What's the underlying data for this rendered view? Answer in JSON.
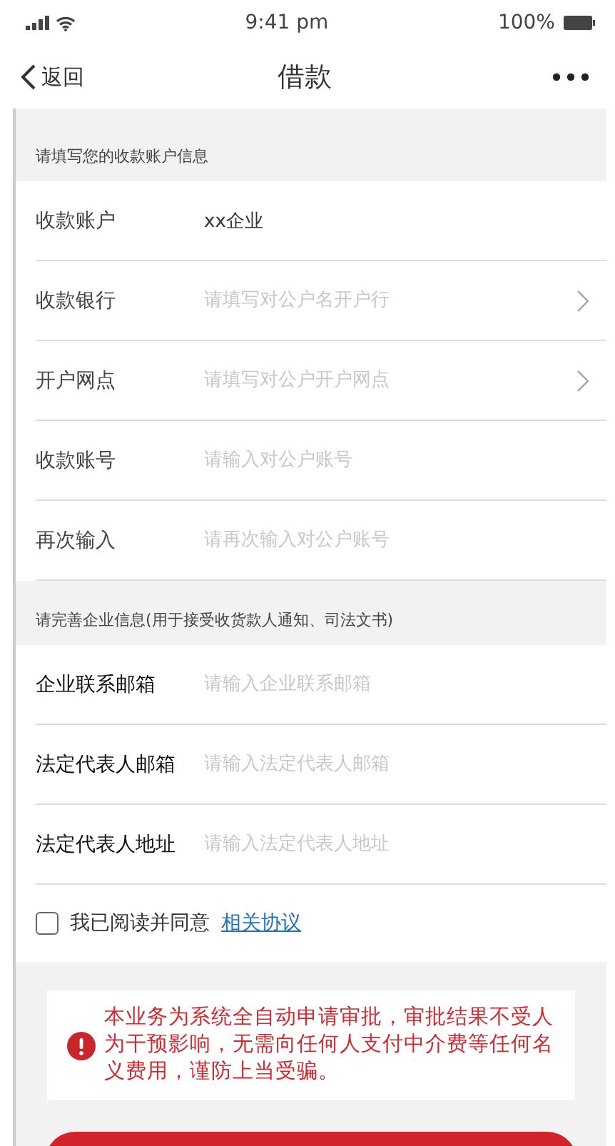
{
  "status_bar": {
    "time": "9:41 pm",
    "battery": "100%"
  },
  "nav": {
    "back": "返回",
    "title": "借款"
  },
  "sections": [
    {
      "header": "请填写您的收款账户信息",
      "fields": [
        {
          "kind": "input",
          "label": "收款账户",
          "value": "xx企业"
        },
        {
          "kind": "select",
          "label": "收款银行",
          "placeholder": "请填写对公户名开户行"
        },
        {
          "kind": "select",
          "label": "开户网点",
          "placeholder": "请填写对公户开户网点"
        },
        {
          "kind": "input",
          "label": "收款账号",
          "placeholder": "请输入对公户账号"
        },
        {
          "kind": "input",
          "label": "再次输入",
          "placeholder": "请再次输入对公户账号"
        }
      ]
    },
    {
      "header": "请完善企业信息(用于接受收货款人通知、司法文书)",
      "fields": [
        {
          "kind": "input",
          "label": "企业联系邮箱",
          "placeholder": "请输入企业联系邮箱"
        },
        {
          "kind": "input",
          "label": "法定代表人邮箱",
          "placeholder": "请输入法定代表人邮箱"
        },
        {
          "kind": "input",
          "label": "法定代表人地址",
          "placeholder": "请输入法定代表人地址"
        }
      ]
    }
  ],
  "agreement": {
    "checked": false,
    "text": "我已阅读并同意",
    "link": "相关协议"
  },
  "notice": {
    "text": "本业务为系统全自动申请审批，审批结果不受人为干预影响，无需向任何人支付中介费等任何名义费用，谨防上当受骗。"
  }
}
